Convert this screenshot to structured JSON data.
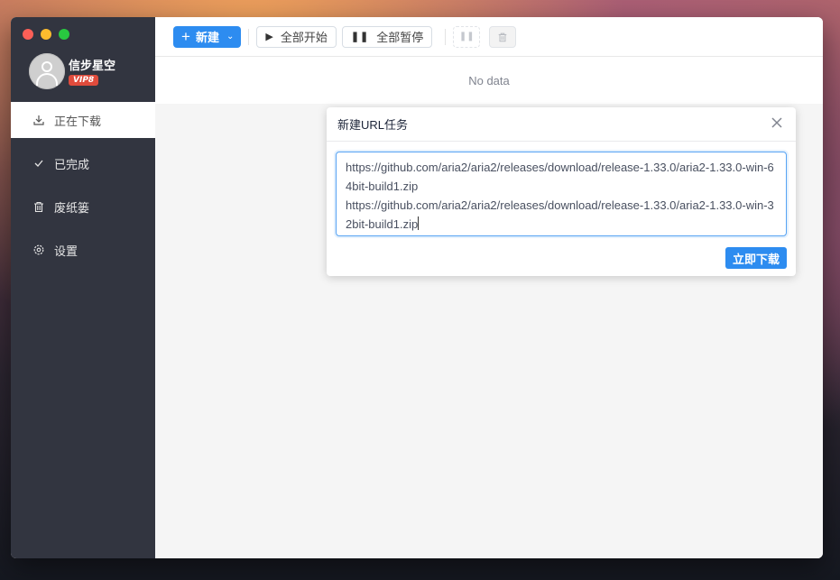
{
  "sidebar": {
    "user": {
      "name": "信步星空",
      "badge": "VIP8"
    },
    "items": [
      {
        "label": "正在下载",
        "icon": "download-icon",
        "active": true
      },
      {
        "label": "已完成",
        "icon": "check-icon",
        "active": false
      },
      {
        "label": "废纸篓",
        "icon": "trash-icon",
        "active": false
      },
      {
        "label": "设置",
        "icon": "gear-icon",
        "active": false
      }
    ]
  },
  "toolbar": {
    "new_label": "新建",
    "start_all_label": "全部开始",
    "pause_all_label": "全部暂停"
  },
  "main": {
    "empty_text": "No data"
  },
  "dialog": {
    "title": "新建URL任务",
    "urls": "https://github.com/aria2/aria2/releases/download/release-1.33.0/aria2-1.33.0-win-64bit-build1.zip\nhttps://github.com/aria2/aria2/releases/download/release-1.33.0/aria2-1.33.0-win-32bit-build1.zip",
    "submit_label": "立即下载"
  },
  "colors": {
    "primary": "#2d8cf0",
    "sidebar_bg": "#323540",
    "vip_badge": "#e04b3c"
  }
}
